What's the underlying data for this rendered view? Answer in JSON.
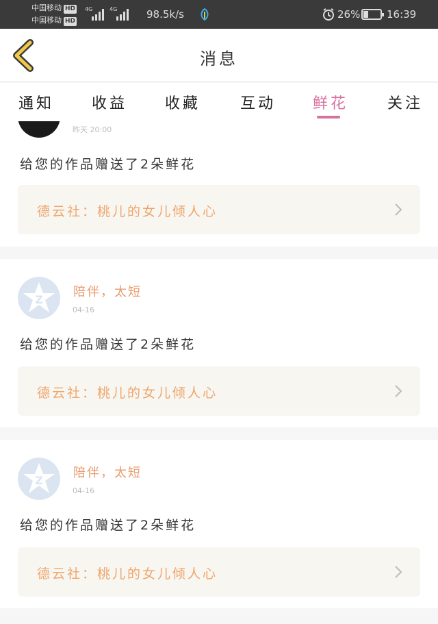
{
  "status_bar": {
    "carrier1": "中国移动",
    "carrier2": "中国移动",
    "hd": "HD",
    "network": "4G",
    "speed": "98.5k/s",
    "battery": "26%",
    "time": "16:39"
  },
  "header": {
    "title": "消息"
  },
  "tabs": [
    {
      "label": "通知"
    },
    {
      "label": "收益"
    },
    {
      "label": "收藏"
    },
    {
      "label": "互动"
    },
    {
      "label": "鲜花",
      "active": true
    },
    {
      "label": "关注"
    }
  ],
  "feed": [
    {
      "user": "",
      "time": "昨天 20:00",
      "message": "给您的作品赠送了2朵鲜花",
      "work": "德云社：桃儿的女儿倾人心"
    },
    {
      "user": "陪伴，太短",
      "time": "04-16",
      "message": "给您的作品赠送了2朵鲜花",
      "work": "德云社：桃儿的女儿倾人心"
    },
    {
      "user": "陪伴，太短",
      "time": "04-16",
      "message": "给您的作品赠送了2朵鲜花",
      "work": "德云社：桃儿的女儿倾人心"
    }
  ],
  "colors": {
    "accent": "#d9719f",
    "username": "#e89a6c",
    "work_title": "#f0a56c",
    "back_icon": "#f2c84b"
  }
}
